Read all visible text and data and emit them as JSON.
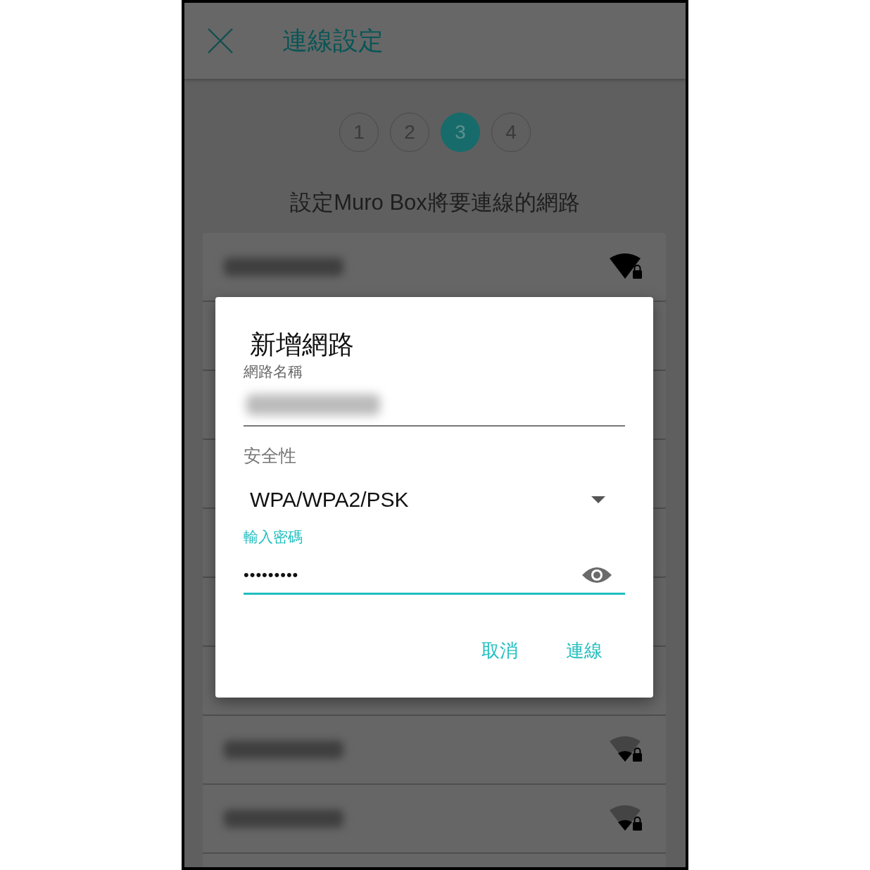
{
  "header": {
    "title": "連線設定"
  },
  "steps": [
    {
      "label": "1",
      "selected": false
    },
    {
      "label": "2",
      "selected": false
    },
    {
      "label": "3",
      "selected": true
    },
    {
      "label": "4",
      "selected": false
    }
  ],
  "subtitle": "設定Muro Box將要連線的網路",
  "networks": [
    {
      "full_signal": true
    },
    {
      "full_signal": false
    },
    {
      "full_signal": false
    }
  ],
  "dialog": {
    "title": "新增網路",
    "name_label": "網路名稱",
    "security_label": "安全性",
    "security_value": "WPA/WPA2/PSK",
    "password_label": "輸入密碼",
    "password_value": "•••••••••",
    "buttons": [
      "取消",
      "連線"
    ]
  }
}
